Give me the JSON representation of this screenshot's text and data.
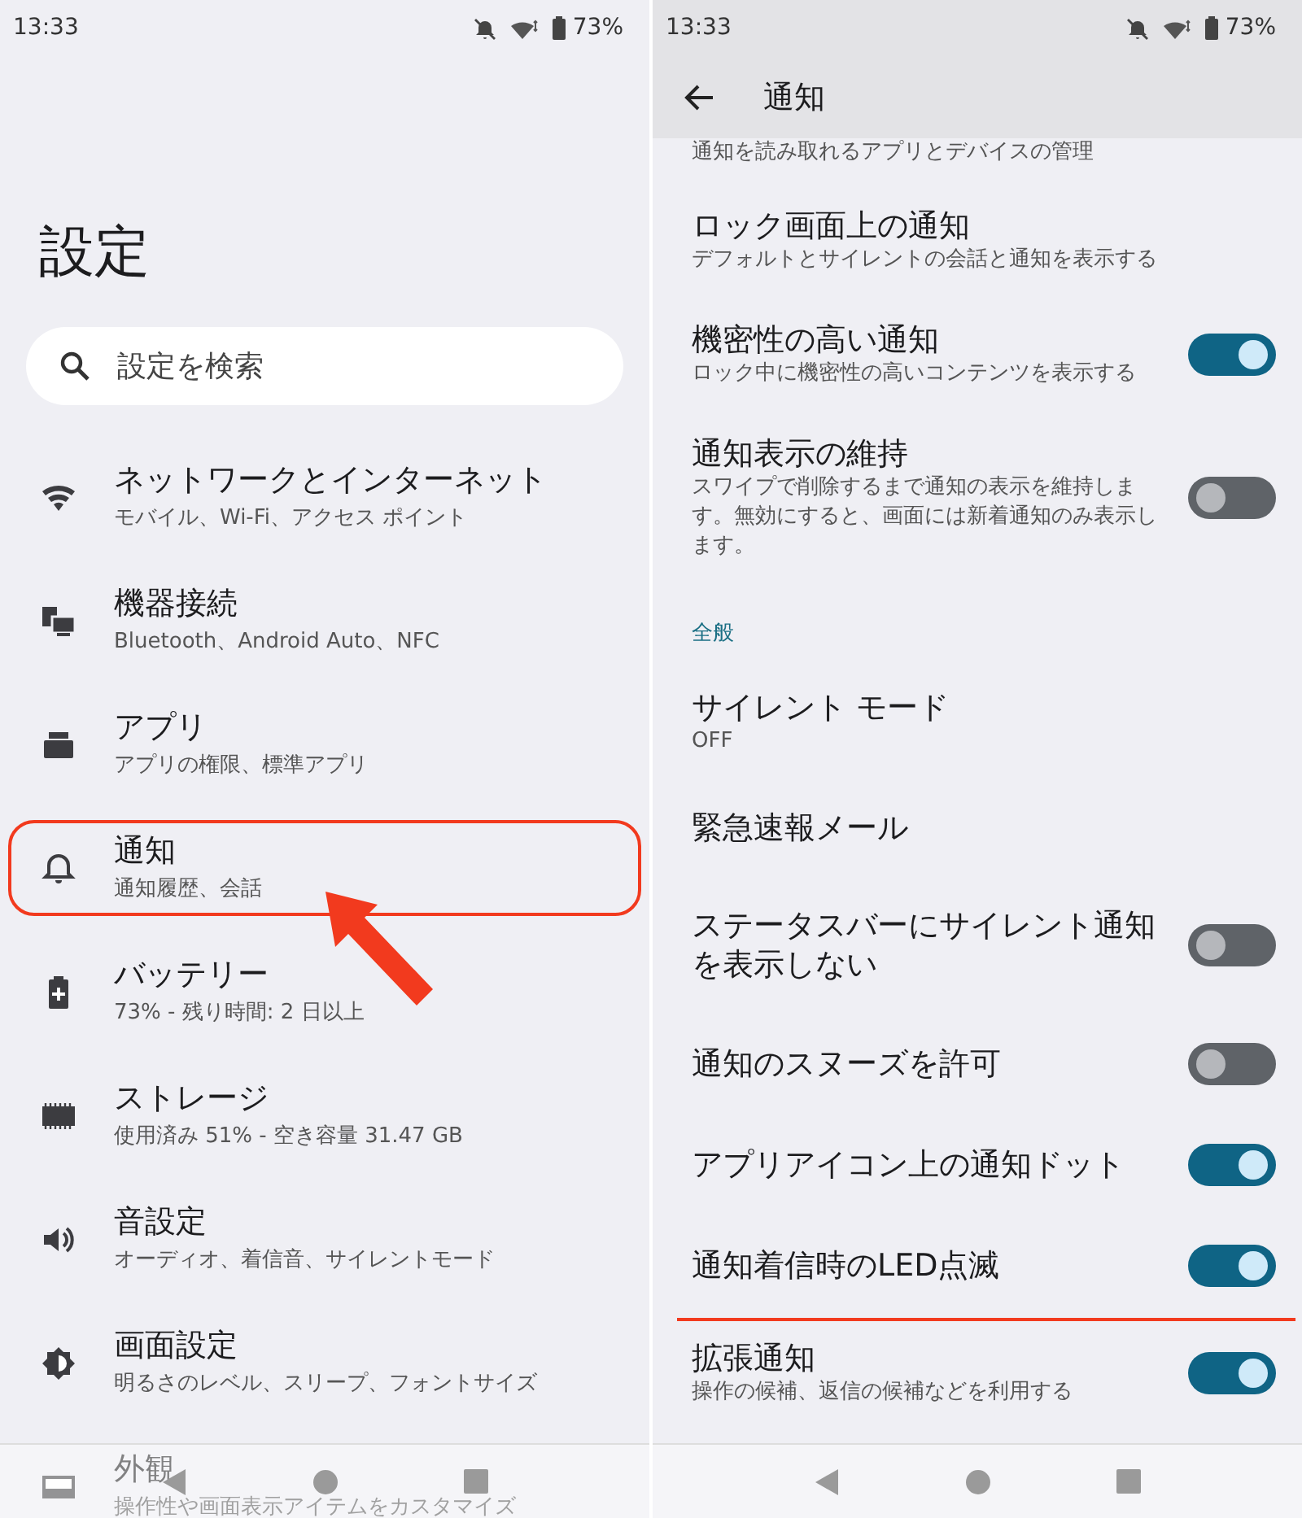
{
  "screens": [
    {
      "status_bar": {
        "time": "13:33",
        "battery": "73%"
      },
      "title": "設定",
      "search": {
        "placeholder": "設定を検索"
      },
      "items": [
        {
          "title": "ネットワークとインターネット",
          "subtitle": "モバイル、Wi-Fi、アクセス ポイント",
          "highlighted": false
        },
        {
          "title": "機器接続",
          "subtitle": "Bluetooth、Android Auto、NFC",
          "highlighted": false
        },
        {
          "title": "アプリ",
          "subtitle": "アプリの権限、標準アプリ",
          "highlighted": false
        },
        {
          "title": "通知",
          "subtitle": "通知履歴、会話",
          "highlighted": true
        },
        {
          "title": "バッテリー",
          "subtitle": "73% - 残り時間: 2 日以上",
          "highlighted": false
        },
        {
          "title": "ストレージ",
          "subtitle": "使用済み 51% - 空き容量 31.47 GB",
          "highlighted": false
        },
        {
          "title": "音設定",
          "subtitle": "オーディオ、着信音、サイレントモード",
          "highlighted": false
        },
        {
          "title": "画面設定",
          "subtitle": "明るさのレベル、スリープ、フォントサイズ",
          "highlighted": false
        },
        {
          "title": "外観",
          "subtitle": "操作性や画面表示アイテムをカスタマイズ",
          "highlighted": false
        }
      ]
    },
    {
      "status_bar": {
        "time": "13:33",
        "battery": "73%"
      },
      "header": {
        "title": "通知"
      },
      "rows": [
        {
          "kind": "text",
          "subtitle": "通知を読み取れるアプリとデバイスの管理"
        },
        {
          "kind": "text",
          "title": "ロック画面上の通知",
          "subtitle": "デフォルトとサイレントの会話と通知を表示する"
        },
        {
          "kind": "toggle",
          "title": "機密性の高い通知",
          "subtitle": "ロック中に機密性の高いコンテンツを表示する",
          "on": true,
          "underlined": false
        },
        {
          "kind": "toggle",
          "title": "通知表示の維持",
          "subtitle": "スワイプで削除するまで通知の表示を維持します。無効にすると、画面には新着通知のみ表示します。",
          "on": false,
          "underlined": false
        },
        {
          "kind": "section",
          "title": "全般"
        },
        {
          "kind": "text",
          "title": "サイレント モード",
          "subtitle": "OFF"
        },
        {
          "kind": "text",
          "title": "緊急速報メール"
        },
        {
          "kind": "toggle",
          "title": "ステータスバーにサイレント通知を表示しない",
          "on": false,
          "underlined": false
        },
        {
          "kind": "toggle",
          "title": "通知のスヌーズを許可",
          "on": false,
          "underlined": false
        },
        {
          "kind": "toggle",
          "title": "アプリアイコン上の通知ドット",
          "on": true,
          "underlined": false
        },
        {
          "kind": "toggle",
          "title": "通知着信時のLED点滅",
          "on": true,
          "underlined": true
        },
        {
          "kind": "toggle",
          "title": "拡張通知",
          "subtitle": "操作の候補、返信の候補などを利用する",
          "on": true,
          "underlined": false
        }
      ]
    }
  ]
}
